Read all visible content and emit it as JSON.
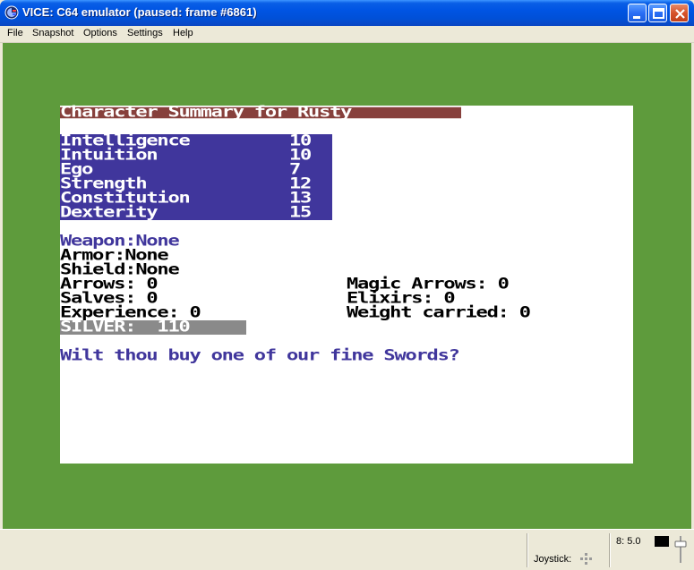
{
  "window": {
    "title": "VICE: C64 emulator (paused: frame #6861)"
  },
  "menu": {
    "items": [
      "File",
      "Snapshot",
      "Options",
      "Settings",
      "Help"
    ]
  },
  "game": {
    "title_line": "Character Summary for Rusty",
    "stats": [
      {
        "name": "Intelligence",
        "value": "10"
      },
      {
        "name": "Intuition",
        "value": "10"
      },
      {
        "name": "Ego",
        "value": "7"
      },
      {
        "name": "Strength",
        "value": "12"
      },
      {
        "name": "Constitution",
        "value": "13"
      },
      {
        "name": "Dexterity",
        "value": "15"
      }
    ],
    "weapon": "Weapon:None",
    "armor": "Armor:None",
    "shield": "Shield:None",
    "arrows": "Arrows: 0",
    "magic_arrows": "Magic Arrows: 0",
    "salves": "Salves: 0",
    "elixirs": "Elixirs: 0",
    "experience": "Experience: 0",
    "weight": "Weight carried: 0",
    "silver": "SILVER:  110",
    "prompt": "Wilt thou buy one of our fine Swords?"
  },
  "status": {
    "drive": "8: 5.0",
    "joystick_label": "Joystick:"
  },
  "colors": {
    "border": "#5e9b3c",
    "screen": "#ffffff",
    "title_bg": "#87403c",
    "stats_bg": "#40369c",
    "silver_bg": "#8a8a8a",
    "text_blue": "#40369c"
  },
  "icons": {
    "app": "vice-app-icon",
    "minimize": "minimize-icon",
    "maximize": "maximize-icon",
    "close": "close-icon",
    "joystick": "joystick-dots-icon",
    "volume": "volume-slider-icon"
  }
}
